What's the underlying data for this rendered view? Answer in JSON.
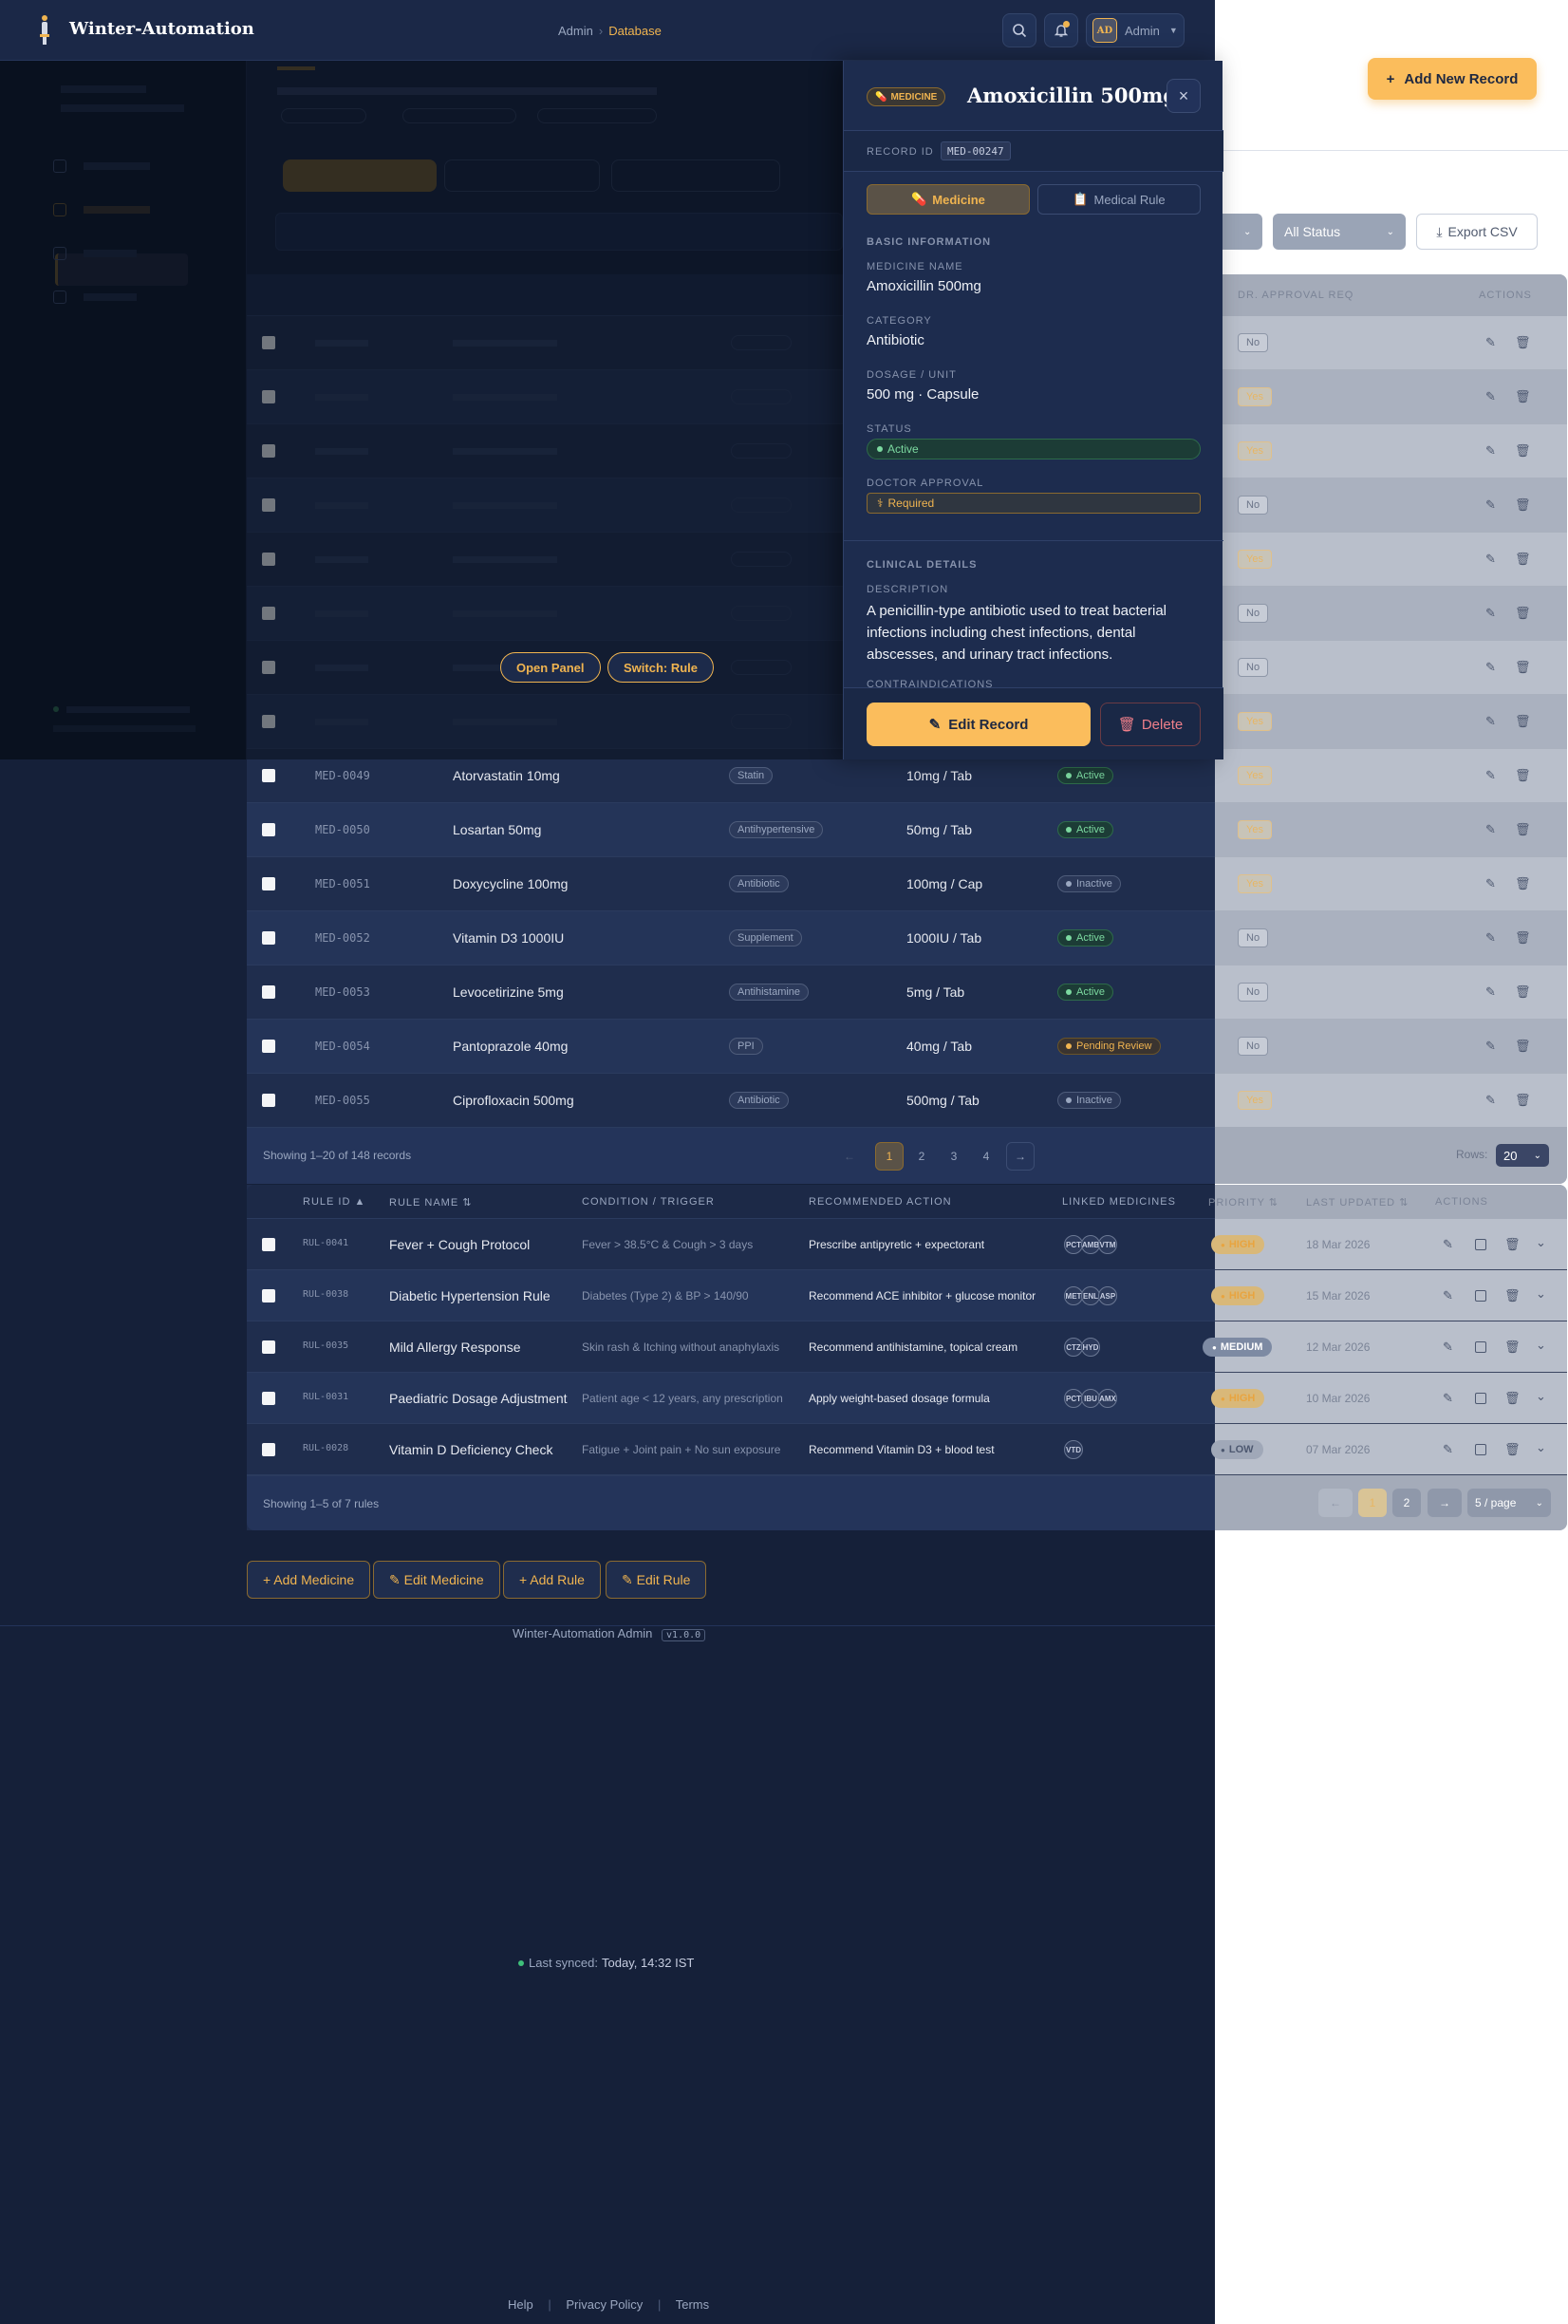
{
  "app": {
    "title": "Winter-Automation"
  },
  "breadcrumb": {
    "root": "Admin",
    "current": "Database"
  },
  "user": {
    "initials": "AD",
    "name": "Admin"
  },
  "colors": {
    "accent": "#f0b450",
    "background": "#152039",
    "success": "#7cd9a0"
  },
  "toolbar": {
    "add_new_record": "Add New Record",
    "status_filter": "All Status",
    "export_csv": "Export CSV"
  },
  "overlay": {
    "open_panel": "Open Panel",
    "switch_rule": "Switch: Rule"
  },
  "medicines": {
    "rows": [
      {
        "id": "MED-0049",
        "name": "Atorvastatin 10mg",
        "category": "Statin",
        "dosage": "10mg / Tab",
        "status": "Active",
        "approval": "Yes"
      },
      {
        "id": "MED-0050",
        "name": "Losartan 50mg",
        "category": "Antihypertensive",
        "dosage": "50mg / Tab",
        "status": "Active",
        "approval": "Yes"
      },
      {
        "id": "MED-0051",
        "name": "Doxycycline 100mg",
        "category": "Antibiotic",
        "dosage": "100mg / Cap",
        "status": "Inactive",
        "approval": "Yes"
      },
      {
        "id": "MED-0052",
        "name": "Vitamin D3 1000IU",
        "category": "Supplement",
        "dosage": "1000IU / Tab",
        "status": "Active",
        "approval": "No"
      },
      {
        "id": "MED-0053",
        "name": "Levocetirizine 5mg",
        "category": "Antihistamine",
        "dosage": "5mg / Tab",
        "status": "Active",
        "approval": "No"
      },
      {
        "id": "MED-0054",
        "name": "Pantoprazole 40mg",
        "category": "PPI",
        "dosage": "40mg / Tab",
        "status": "Pending Review",
        "approval": "No"
      },
      {
        "id": "MED-0055",
        "name": "Ciprofloxacin 500mg",
        "category": "Antibiotic",
        "dosage": "500mg / Tab",
        "status": "Inactive",
        "approval": "Yes"
      }
    ],
    "ghost_approval": [
      "No",
      "Yes",
      "Yes",
      "No",
      "Yes",
      "No",
      "No",
      "Yes"
    ],
    "dr_approval_header": "DR. APPROVAL REQ",
    "actions_header": "ACTIONS",
    "showing": "Showing 1–20 of 148 records",
    "pages": [
      "1",
      "2",
      "3",
      "4"
    ],
    "prev": "←",
    "next": "→",
    "rows_label": "Rows:",
    "rows_value": "20"
  },
  "panel": {
    "badge": "MEDICINE",
    "title": "Amoxicillin 500mg",
    "record_id_label": "RECORD ID",
    "record_id": "MED-00247",
    "tab_medicine": "Medicine",
    "tab_rule": "Medical Rule",
    "basic_info": "BASIC INFORMATION",
    "name_label": "MEDICINE NAME",
    "name_value": "Amoxicillin 500mg",
    "category_label": "CATEGORY",
    "category_value": "Antibiotic",
    "dosage_label": "DOSAGE / UNIT",
    "dosage_value": "500 mg · Capsule",
    "status_label": "STATUS",
    "status_value": "Active",
    "approval_label": "DOCTOR APPROVAL",
    "approval_value": "Required",
    "clinical_details": "CLINICAL DETAILS",
    "description_label": "DESCRIPTION",
    "description_value": "A penicillin-type antibiotic used to treat bacterial infections including chest infections, dental abscesses, and urinary tract infections.",
    "contra_label": "CONTRAINDICATIONS",
    "edit_button": "Edit Record",
    "delete_button": "Delete"
  },
  "rules": {
    "headers": {
      "rule_id": "RULE ID ▲",
      "rule_name": "RULE NAME ⇅",
      "condition": "CONDITION / TRIGGER",
      "action": "RECOMMENDED ACTION",
      "linked": "LINKED MEDICINES",
      "priority": "PRIORITY ⇅",
      "updated": "LAST UPDATED ⇅",
      "actions": "ACTIONS"
    },
    "rows": [
      {
        "id": "RUL-0041",
        "name": "Fever + Cough Protocol",
        "condition": "Fever > 38.5°C & Cough > 3 days",
        "action": "Prescribe antipyretic + expectorant",
        "linked": [
          "PCT",
          "AMB",
          "VTM"
        ],
        "priority": "HIGH",
        "updated": "18 Mar 2026"
      },
      {
        "id": "RUL-0038",
        "name": "Diabetic Hypertension Rule",
        "condition": "Diabetes (Type 2) & BP > 140/90",
        "action": "Recommend ACE inhibitor + glucose monitor",
        "linked": [
          "MET",
          "ENL",
          "ASP"
        ],
        "priority": "HIGH",
        "updated": "15 Mar 2026"
      },
      {
        "id": "RUL-0035",
        "name": "Mild Allergy Response",
        "condition": "Skin rash & Itching without anaphylaxis",
        "action": "Recommend antihistamine, topical cream",
        "linked": [
          "CTZ",
          "HYD"
        ],
        "priority": "MEDIUM",
        "updated": "12 Mar 2026"
      },
      {
        "id": "RUL-0031",
        "name": "Paediatric Dosage Adjustment",
        "condition": "Patient age < 12 years, any prescription",
        "action": "Apply weight-based dosage formula",
        "linked": [
          "PCT",
          "IBU",
          "AMX"
        ],
        "priority": "HIGH",
        "updated": "10 Mar 2026"
      },
      {
        "id": "RUL-0028",
        "name": "Vitamin D Deficiency Check",
        "condition": "Fatigue + Joint pain + No sun exposure",
        "action": "Recommend Vitamin D3 + blood test",
        "linked": [
          "VTD"
        ],
        "priority": "LOW",
        "updated": "07 Mar 2026"
      }
    ],
    "showing": "Showing 1–5 of 7 rules",
    "pages": [
      "1",
      "2"
    ],
    "per_page": "5 / page"
  },
  "bottom_actions": {
    "add_medicine": "+ Add Medicine",
    "edit_medicine": "✎ Edit Medicine",
    "add_rule": "+ Add Rule",
    "edit_rule": "✎ Edit Rule"
  },
  "footer": {
    "app_name": "Winter-Automation Admin",
    "version": "v1.0.0",
    "synced_label": "Last synced:",
    "synced_value": "Today, 14:32 IST",
    "help": "Help",
    "privacy": "Privacy Policy",
    "terms": "Terms"
  }
}
